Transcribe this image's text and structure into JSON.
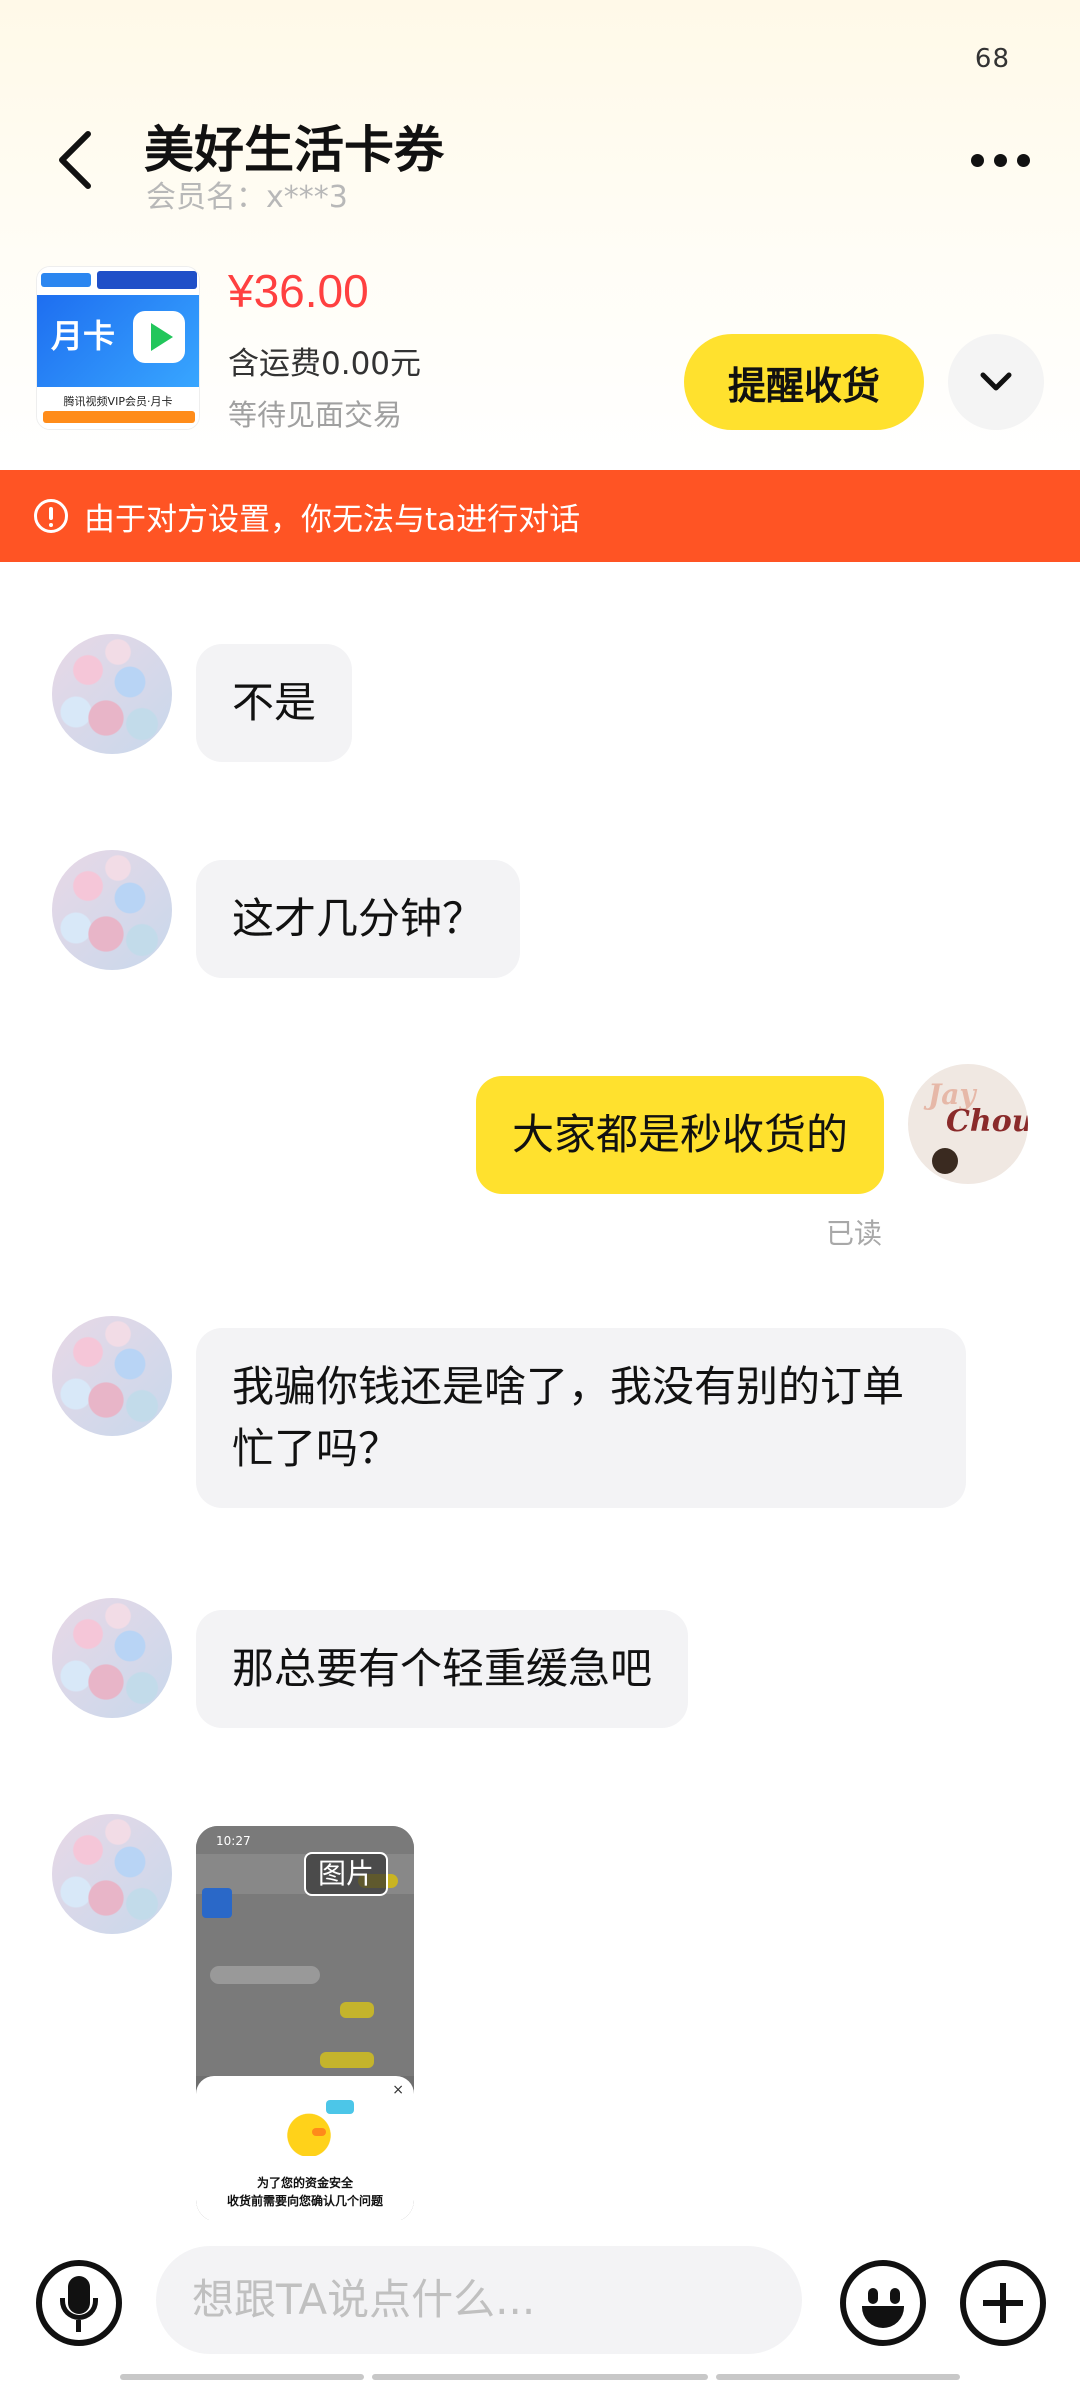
{
  "status": {
    "number": "68"
  },
  "header": {
    "title": "美好生活卡券",
    "member": "会员名：x***3"
  },
  "product": {
    "price": "¥36.00",
    "shipping": "含运费0.00元",
    "status": "等待见面交易",
    "remind_label": "提醒收货",
    "thumb": {
      "card_label": "月卡",
      "caption": "腾讯视频VIP会员·月卡"
    }
  },
  "warning": {
    "text": "由于对方设置，你无法与ta进行对话"
  },
  "messages": [
    {
      "side": "left",
      "text": "不是"
    },
    {
      "side": "left",
      "text": "这才几分钟？"
    },
    {
      "side": "right",
      "text": "大家都是秒收货的",
      "status": "已读"
    },
    {
      "side": "left",
      "text": "我骗你钱还是啥了，我没有别的订单忙了吗？"
    },
    {
      "side": "left",
      "text": "那总要有个轻重缓急吧"
    },
    {
      "side": "left",
      "type": "image",
      "tag": "图片",
      "preview_time": "10:27",
      "dialog_line1": "为了您的资金安全",
      "dialog_line2": "收货前需要向您确认几个问题"
    }
  ],
  "my_avatar": {
    "text1": "Jay",
    "text2": "Chou"
  },
  "input": {
    "placeholder": "想跟TA说点什么..."
  },
  "icons": {
    "back": "chevron-left-icon",
    "more": "more-dots-icon",
    "expand": "chevron-down-icon",
    "warning": "exclamation-circle-icon",
    "mic": "microphone-icon",
    "emoji": "smiley-icon",
    "plus": "plus-icon"
  },
  "colors": {
    "accent": "#ffe12e",
    "warning_bar": "#ff5424",
    "price": "#ff4040"
  }
}
